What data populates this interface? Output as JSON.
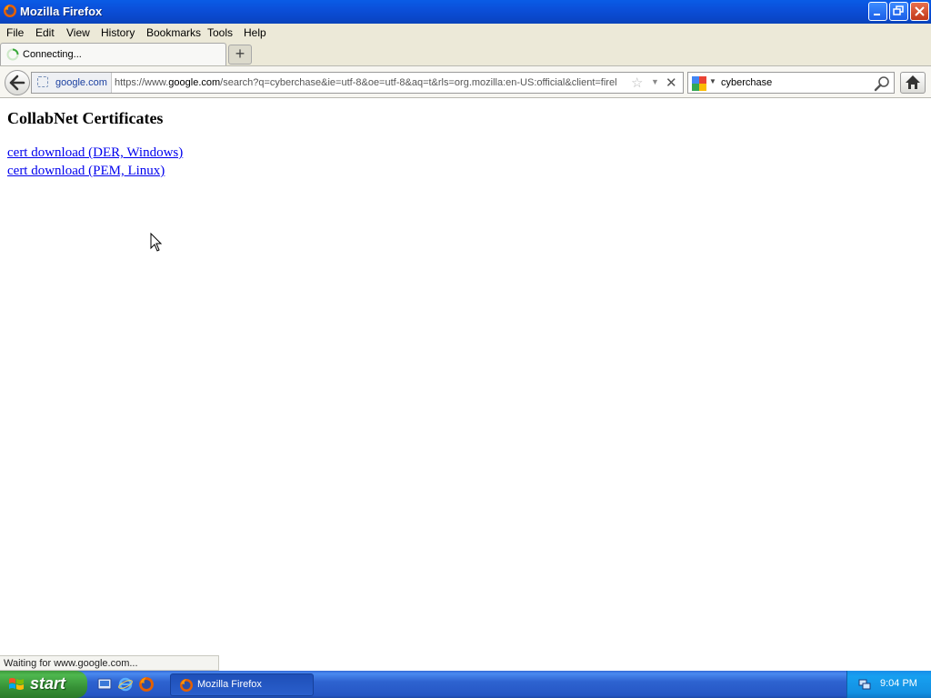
{
  "window": {
    "title": "Mozilla Firefox"
  },
  "menu": [
    "File",
    "Edit",
    "View",
    "History",
    "Bookmarks",
    "Tools",
    "Help"
  ],
  "tab": {
    "label": "Connecting..."
  },
  "navbar": {
    "identity_domain": "google.com",
    "url_prefix": "https://www.",
    "url_host": "google.com",
    "url_rest": "/search?q=cyberchase&ie=utf-8&oe=utf-8&aq=t&rls=org.mozilla:en-US:official&client=firel",
    "search_query": "cyberchase"
  },
  "page": {
    "heading": "CollabNet Certificates",
    "links": [
      "cert download (DER, Windows)",
      "cert download (PEM, Linux)"
    ]
  },
  "status": {
    "text": "Waiting for www.google.com..."
  },
  "taskbar": {
    "start_label": "start",
    "task_label": "Mozilla Firefox",
    "clock": "9:04 PM"
  }
}
